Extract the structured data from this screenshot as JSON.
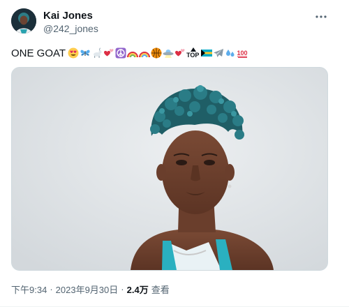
{
  "author": {
    "display_name": "Kai Jones",
    "handle": "@242_jones",
    "avatar_icon": "avatar-portrait"
  },
  "more_icon": "more-horizontal-icon",
  "tweet": {
    "text": "ONE GOAT",
    "emojis": [
      "heart-eyes",
      "butterfly",
      "goat",
      "two-hearts",
      "peace-symbol",
      "rainbow",
      "rainbow",
      "basketball",
      "ufo",
      "two-hearts",
      "top-arrow",
      "bahamas-flag",
      "airplane",
      "droplets",
      "hundred"
    ],
    "top_label": "TOP"
  },
  "media": {
    "description_icon": "player-photo",
    "background_color": "#dfe3e6"
  },
  "meta": {
    "time": "下午9:34",
    "date": "2023年9月30日",
    "separator": "·",
    "views_count": "2.4万",
    "views_label": "查看"
  },
  "colors": {
    "text_primary": "#0f1419",
    "text_secondary": "#536471",
    "border": "#cfd9de"
  }
}
